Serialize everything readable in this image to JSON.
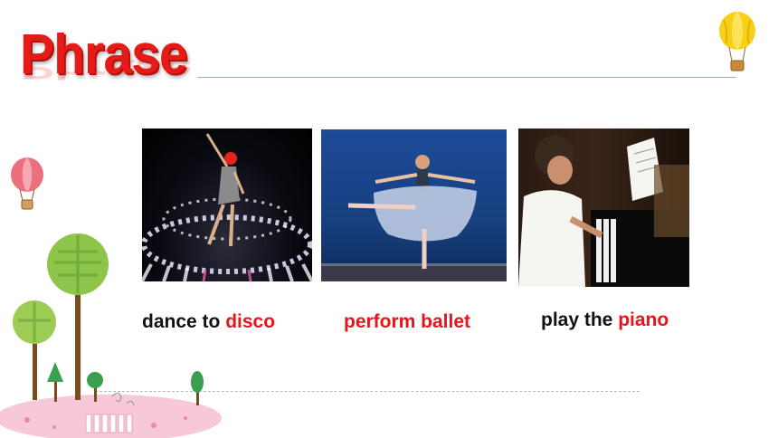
{
  "page": {
    "title": "Phrase"
  },
  "phrases": [
    {
      "prefix": "dance to ",
      "highlight": "disco",
      "image": "disco-dancer-photo"
    },
    {
      "prefix": "",
      "highlight": "perform ballet",
      "image": "ballet-dancer-photo"
    },
    {
      "prefix": "play the ",
      "highlight": "piano",
      "image": "boy-playing-piano-photo"
    }
  ],
  "colors": {
    "title": "#e41b17",
    "highlight": "#e8141b",
    "text": "#111111",
    "rule": "#8fbf8f"
  }
}
